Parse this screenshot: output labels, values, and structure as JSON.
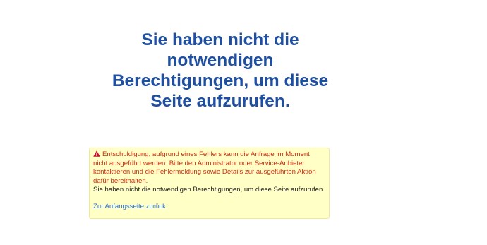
{
  "heading": {
    "title": "Sie haben nicht die notwendigen Berechtigungen, um diese Seite aufzurufen."
  },
  "error_box": {
    "icon": "warning-triangle-icon",
    "error_message": "Entschuldigung, aufgrund eines Fehlers kann die Anfrage im Moment nicht ausgeführt werden. Bitte den Administrator oder Service-Anbieter kontaktieren und die Fehlermeldung sowie Details zur ausgeführten Aktion dafür bereithalten.",
    "info_message": "Sie haben nicht die notwendigen Berechtigungen, um diese Seite aufzurufen.",
    "back_link_label": "Zur Anfangsseite zurück."
  },
  "colors": {
    "title": "#1f4fa0",
    "error_text": "#d02a10",
    "box_background": "#ffffc6",
    "box_border": "#ede89a",
    "link": "#2a6fd6"
  }
}
